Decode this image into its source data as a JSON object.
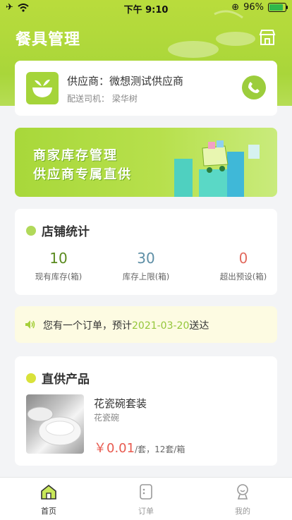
{
  "status_bar": {
    "time": "下午 9:10",
    "battery": "96%"
  },
  "header": {
    "title": "餐具管理"
  },
  "supplier": {
    "name": "供应商：微想测试供应商",
    "driver": "配送司机：  梁华树"
  },
  "banner": {
    "line1": "商家库存管理",
    "line2": "供应商专属直供"
  },
  "stats": {
    "title": "店铺统计",
    "items": [
      {
        "value": "10",
        "label": "现有库存(箱)",
        "color": "#5a8a1e"
      },
      {
        "value": "30",
        "label": "库存上限(箱)",
        "color": "#5e8fa6"
      },
      {
        "value": "0",
        "label": "超出预设(箱)",
        "color": "#e26a5e"
      }
    ]
  },
  "notice": {
    "prefix": "您有一个订单，预计",
    "date": "2021-03-20",
    "suffix": "送达"
  },
  "products": {
    "title": "直供产品",
    "items": [
      {
        "name": "花瓷碗套装",
        "sub": "花瓷碗",
        "price": "￥0.01",
        "unit": "/套，12套/箱"
      }
    ]
  },
  "tabs": [
    {
      "label": "首页",
      "icon": "home-icon",
      "active": true
    },
    {
      "label": "订单",
      "icon": "order-icon",
      "active": false
    },
    {
      "label": "我的",
      "icon": "profile-icon",
      "active": false
    }
  ],
  "colors": {
    "brand": "#a5d43a",
    "accent_yellow": "#d9e23a",
    "price_red": "#e85a4f"
  }
}
